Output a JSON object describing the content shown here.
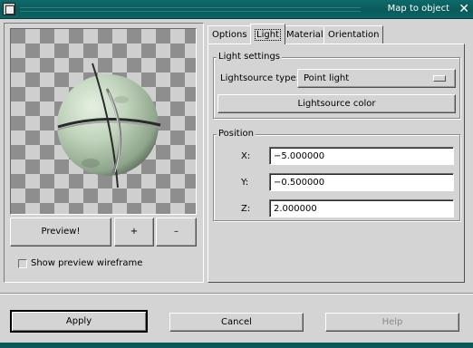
{
  "window": {
    "title": "Map to object",
    "close_glyph": "✕"
  },
  "preview": {
    "button_label": "Preview!",
    "zoom_in_label": "+",
    "zoom_out_label": "–",
    "wireframe_checkbox_label": "Show preview wireframe",
    "wireframe_checked": false
  },
  "tabs": [
    {
      "label": "Options",
      "active": false
    },
    {
      "label": "Light",
      "active": true
    },
    {
      "label": "Material",
      "active": false
    },
    {
      "label": "Orientation",
      "active": false
    }
  ],
  "light_settings": {
    "group_title": "Light settings",
    "type_label": "Lightsource type:",
    "type_value": "Point light",
    "color_button_label": "Lightsource color"
  },
  "position": {
    "group_title": "Position",
    "x_label": "X:",
    "x_value": "−5.000000",
    "y_label": "Y:",
    "y_value": "−0.500000",
    "z_label": "Z:",
    "z_value": "2.000000"
  },
  "footer": {
    "apply_label": "Apply",
    "cancel_label": "Cancel",
    "help_label": "Help",
    "help_enabled": false
  },
  "colors": {
    "titlebar": "#0a5a5a",
    "dialog_bg": "#d4d4d4",
    "sphere": "#c7d8c4"
  }
}
